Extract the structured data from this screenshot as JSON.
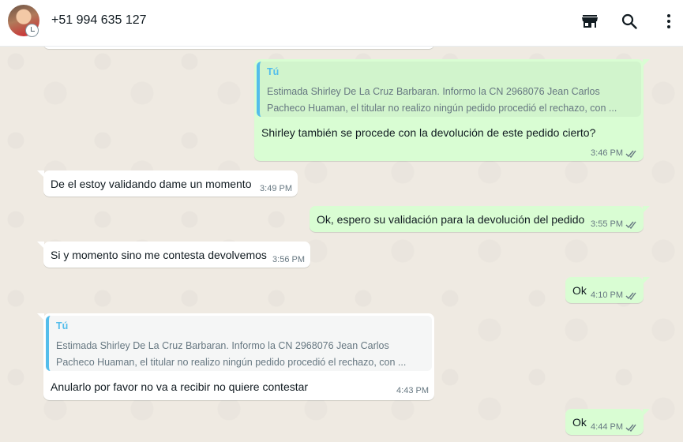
{
  "header": {
    "contact": "+51 994 635 127",
    "icons": [
      "store-icon",
      "search-icon",
      "menu-icon"
    ]
  },
  "colors": {
    "incoming": "#ffffff",
    "outgoing": "#d9fdd3",
    "quote_accent": "#53bdeb",
    "read_ticks": "#53bdeb",
    "chat_bg": "#efeae2"
  },
  "messages": [
    {
      "direction": "out",
      "quote_author": "Tú",
      "quote_line1": "Estimada Shirley De La Cruz Barbaran. Informo la CN 2968076 Jean Carlos",
      "quote_line2": "Pacheco Huaman, el titular no realizo ningún pedido procedió el rechazo, con ...",
      "text": "Shirley también se procede con la devolución de este pedido cierto?",
      "time": "3:46 PM"
    },
    {
      "direction": "in",
      "text": "De el estoy validando dame un momento",
      "time": "3:49 PM"
    },
    {
      "direction": "out",
      "text": "Ok, espero su validación para la devolución del pedido",
      "time": "3:55 PM"
    },
    {
      "direction": "in",
      "text": "Si y momento sino me contesta devolvemos",
      "time": "3:56 PM"
    },
    {
      "direction": "out",
      "text": "Ok",
      "time": "4:10 PM"
    },
    {
      "direction": "in",
      "quote_author": "Tú",
      "quote_line1": "Estimada Shirley De La Cruz Barbaran. Informo la CN 2968076 Jean Carlos",
      "quote_line2": "Pacheco Huaman, el titular no realizo ningún pedido procedió el rechazo, con ...",
      "text": "Anularlo por favor no va a recibir no quiere contestar",
      "time": "4:43 PM"
    },
    {
      "direction": "out",
      "text": "Ok",
      "time": "4:44 PM"
    }
  ]
}
